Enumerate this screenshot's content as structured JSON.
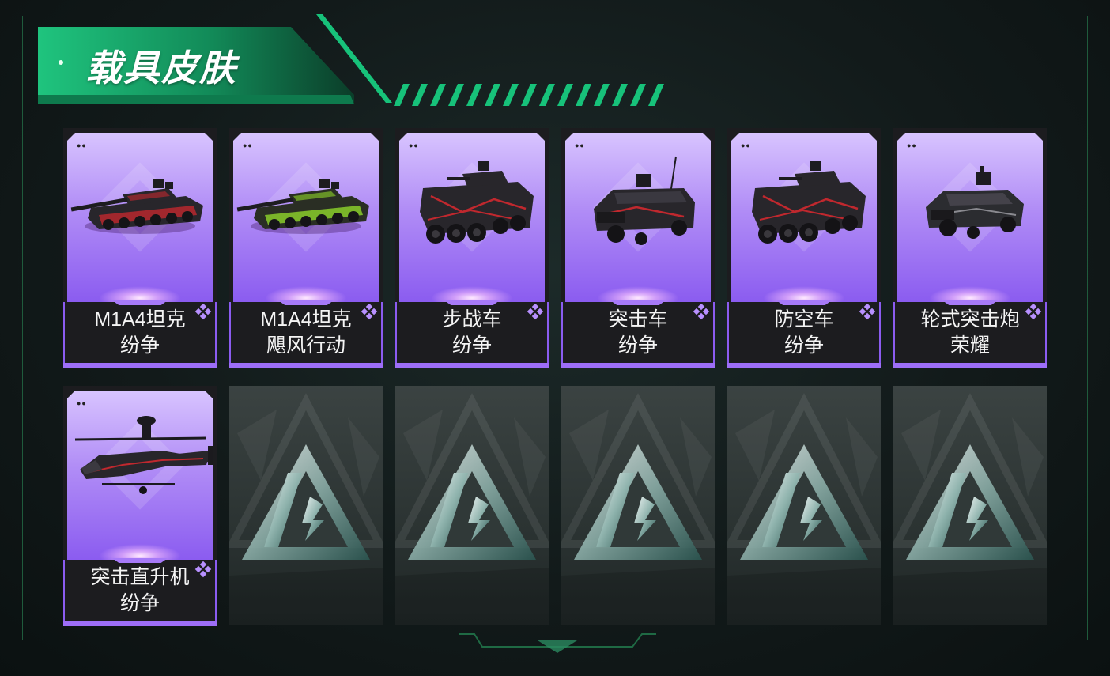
{
  "header": {
    "title": "载具皮肤"
  },
  "colors": {
    "accent_green": "#17c27a",
    "rarity_purple": "#9d6ef7",
    "card_bg": "#1c1c1f"
  },
  "cards": [
    {
      "name": "M1A4坦克",
      "skin": "纷争",
      "vehicle": "tank",
      "camo": "black-red"
    },
    {
      "name": "M1A4坦克",
      "skin": "飓风行动",
      "vehicle": "tank",
      "camo": "green-black"
    },
    {
      "name": "步战车",
      "skin": "纷争",
      "vehicle": "ifv",
      "camo": "black-red"
    },
    {
      "name": "突击车",
      "skin": "纷争",
      "vehicle": "assault-car",
      "camo": "black-red"
    },
    {
      "name": "防空车",
      "skin": "纷争",
      "vehicle": "ifv",
      "camo": "black-red"
    },
    {
      "name": "轮式突击炮",
      "skin": "荣耀",
      "vehicle": "armored-car",
      "camo": "black-grey"
    },
    {
      "name": "突击直升机",
      "skin": "纷争",
      "vehicle": "helicopter",
      "camo": "black-red"
    }
  ],
  "empty_slots": 5
}
